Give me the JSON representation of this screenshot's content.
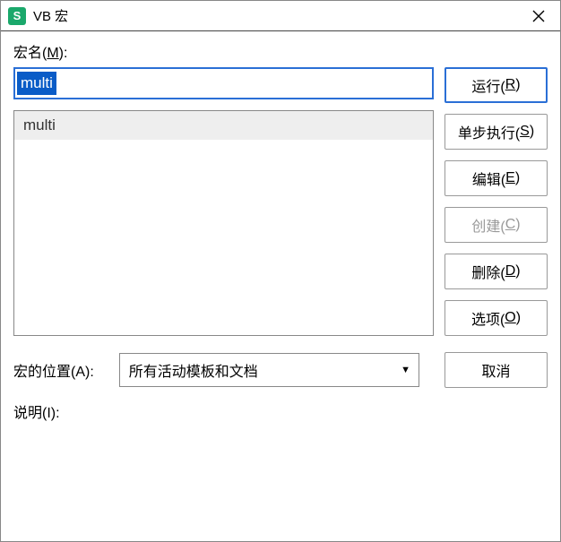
{
  "titlebar": {
    "icon_letter": "S",
    "title": "VB 宏"
  },
  "labels": {
    "macro_name_prefix": "宏名(",
    "macro_name_key": "M",
    "macro_name_suffix": "):",
    "location_prefix": "宏的位置(",
    "location_key": "A",
    "location_suffix": "):",
    "description_prefix": "说明(",
    "description_key": "I",
    "description_suffix": "):"
  },
  "macro_name_value": "multi",
  "macro_list": [
    "multi"
  ],
  "location_value": "所有活动模板和文档",
  "buttons": {
    "run_prefix": "运行(",
    "run_key": "R",
    "run_suffix": ")",
    "step_prefix": "单步执行(",
    "step_key": "S",
    "step_suffix": ")",
    "edit_prefix": "编辑(",
    "edit_key": "E",
    "edit_suffix": ")",
    "create_prefix": "创建(",
    "create_key": "C",
    "create_suffix": ")",
    "delete_prefix": "删除(",
    "delete_key": "D",
    "delete_suffix": ")",
    "options_prefix": "选项(",
    "options_key": "O",
    "options_suffix": ")",
    "cancel": "取消"
  }
}
